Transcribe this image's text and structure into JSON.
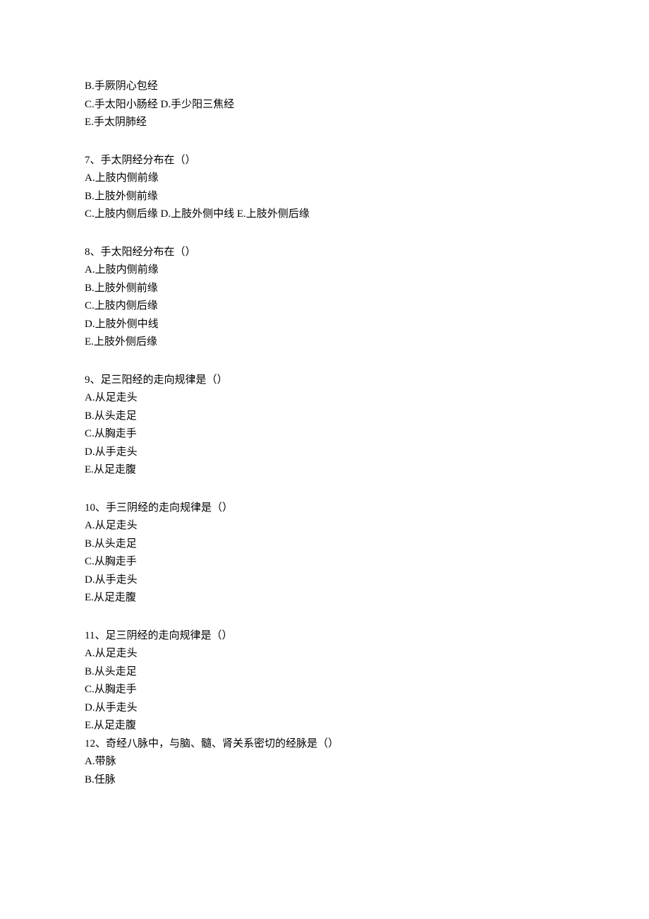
{
  "q6_tail": {
    "options": [
      "B.手厥阴心包经",
      "C.手太阳小肠经 D.手少阳三焦经",
      "E.手太阴肺经"
    ]
  },
  "q7": {
    "question": "7、手太阴经分布在（）",
    "options": [
      "A.上肢内侧前缘",
      "B.上肢外侧前缘",
      "C.上肢内侧后缘 D.上肢外侧中线 E.上肢外侧后缘"
    ]
  },
  "q8": {
    "question": "8、手太阳经分布在（）",
    "options": [
      "A.上肢内侧前缘",
      "B.上肢外侧前缘",
      "C.上肢内侧后缘",
      "D.上肢外侧中线",
      "E.上肢外侧后缘"
    ]
  },
  "q9": {
    "question": "9、足三阳经的走向规律是（）",
    "options": [
      "A.从足走头",
      "B.从头走足",
      "C.从胸走手",
      "D.从手走头",
      "E.从足走腹"
    ]
  },
  "q10": {
    "question": "10、手三阴经的走向规律是（）",
    "options": [
      "A.从足走头",
      "B.从头走足",
      "C.从胸走手",
      "D.从手走头",
      "E.从足走腹"
    ]
  },
  "q11": {
    "question": "11、足三阴经的走向规律是（）",
    "options": [
      "A.从足走头",
      "B.从头走足",
      "C.从胸走手",
      "D.从手走头",
      "E.从足走腹"
    ]
  },
  "q12": {
    "question": "12、奇经八脉中，与脑、髓、肾关系密切的经脉是（）",
    "options": [
      "A.带脉",
      "B.任脉"
    ]
  }
}
